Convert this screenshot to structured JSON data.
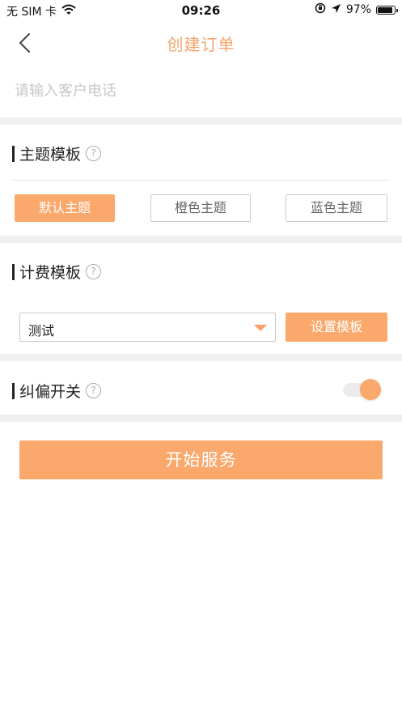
{
  "status_bar": {
    "carrier": "无 SIM 卡",
    "time": "09:26",
    "battery": "97%",
    "battery_level": 0.97
  },
  "nav": {
    "title": "创建订单"
  },
  "phone": {
    "value": "",
    "placeholder": "请输入客户电话"
  },
  "theme_section": {
    "title": "主题模板",
    "help": "?",
    "options": [
      "默认主题",
      "橙色主题",
      "蓝色主题"
    ],
    "selected": "默认主题"
  },
  "billing_section": {
    "title": "计费模板",
    "help": "?",
    "selected_template": "测试",
    "set_button": "设置模板"
  },
  "correction_section": {
    "title": "纠偏开关",
    "help": "?",
    "enabled": true
  },
  "start_button": "开始服务",
  "colors": {
    "accent": "#fba86c",
    "title": "#f5a36a",
    "band": "#f0f0f0"
  }
}
